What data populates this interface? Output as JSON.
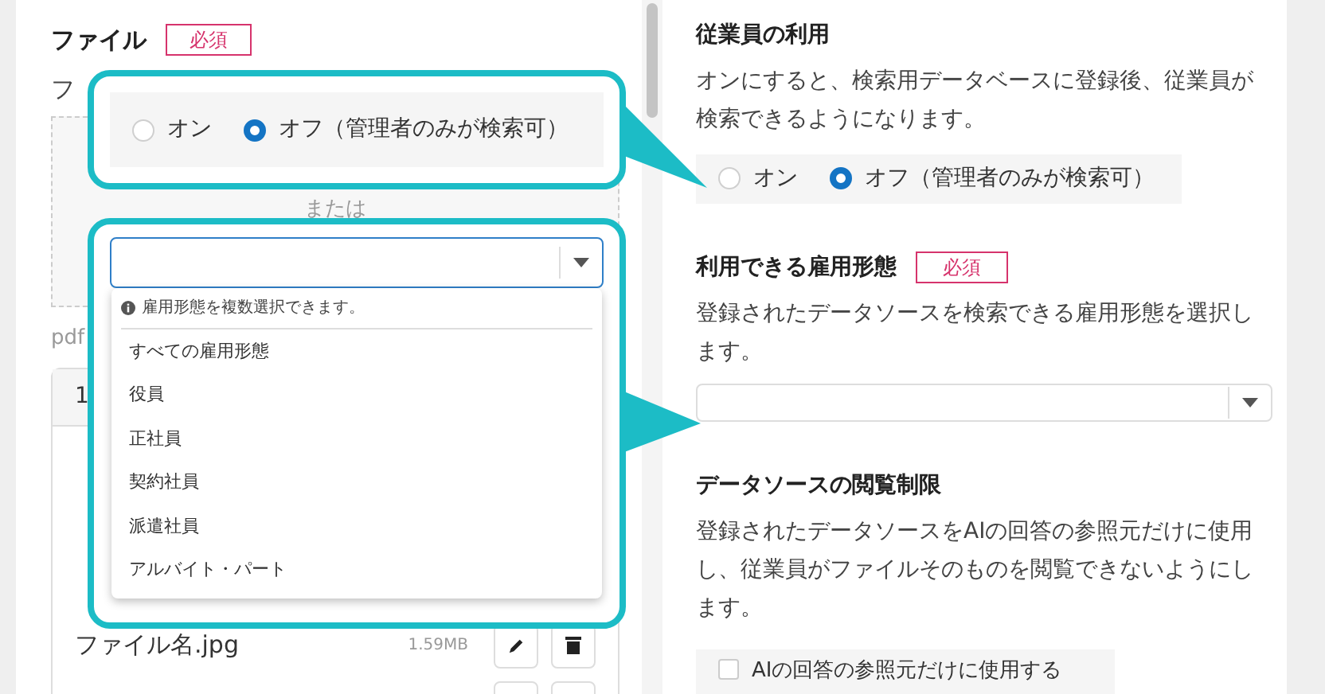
{
  "left_form": {
    "title": "ファイル",
    "required_badge": "必須",
    "hint": "フ",
    "drop_zone": {
      "separator": "または"
    },
    "file_note": "pdf",
    "file_table": {
      "header": "1",
      "files": [
        {
          "name": "ファイル名.jpg",
          "size": "1.59MB"
        }
      ]
    }
  },
  "right_form": {
    "employee_use": {
      "title": "従業員の利用",
      "description": "オンにすると、検索用データベースに登録後、従業員が検索できるようになります。",
      "options": [
        {
          "label": "オン",
          "selected": false
        },
        {
          "label": "オフ（管理者のみが検索可）",
          "selected": true
        }
      ]
    },
    "employment_types": {
      "title": "利用できる雇用形態",
      "required_badge": "必須",
      "description": "登録されたデータソースを検索できる雇用形態を選択します。"
    },
    "view_restriction": {
      "title": "データソースの閲覧制限",
      "description": "登録されたデータソースをAIの回答の参照元だけに使用し、従業員がファイルそのものを閲覧できないようにします。",
      "checkbox": {
        "label": "AIの回答の参照元だけに使用する",
        "checked": false
      }
    }
  },
  "callouts": [
    {
      "kind": "radio",
      "options": [
        {
          "label": "オン",
          "selected": false
        },
        {
          "label": "オフ（管理者のみが検索可）",
          "selected": true
        }
      ]
    },
    {
      "kind": "dropdown",
      "hint": "雇用形態を複数選択できます。",
      "options": [
        "すべての雇用形態",
        "役員",
        "正社員",
        "契約社員",
        "派遣社員",
        "アルバイト・パート"
      ]
    }
  ]
}
